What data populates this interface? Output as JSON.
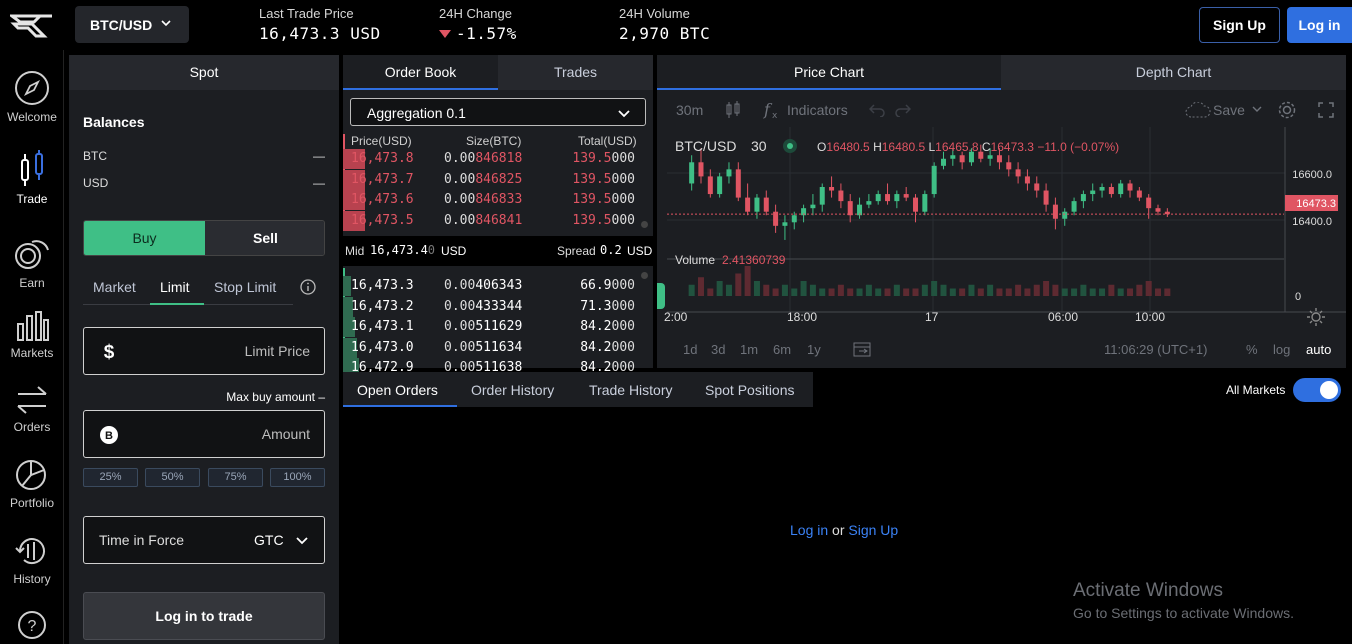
{
  "topbar": {
    "pair": "BTC/USD",
    "last_trade_label": "Last Trade Price",
    "last_trade_value": "16,473.3 USD",
    "change_label": "24H Change",
    "change_value": "-1.57%",
    "volume_label": "24H Volume",
    "volume_value": "2,970 BTC",
    "signup": "Sign Up",
    "login": "Log in"
  },
  "rail": {
    "items": [
      {
        "label": "Welcome",
        "icon": "compass-icon"
      },
      {
        "label": "Trade",
        "icon": "candlestick-icon"
      },
      {
        "label": "Earn",
        "icon": "coins-icon"
      },
      {
        "label": "Markets",
        "icon": "bars-icon"
      },
      {
        "label": "Orders",
        "icon": "arrows-exchange-icon"
      },
      {
        "label": "Portfolio",
        "icon": "pie-icon"
      },
      {
        "label": "History",
        "icon": "history-icon"
      }
    ],
    "help_icon": "question-icon"
  },
  "spot": {
    "title": "Spot",
    "balances_title": "Balances",
    "balances": [
      {
        "asset": "BTC",
        "value": "—"
      },
      {
        "asset": "USD",
        "value": "—"
      }
    ],
    "buy": "Buy",
    "sell": "Sell",
    "order_types": [
      "Market",
      "Limit",
      "Stop Limit"
    ],
    "limit_price_placeholder": "Limit Price",
    "max_buy": "Max buy amount –",
    "amount_placeholder": "Amount",
    "percents": [
      "25%",
      "50%",
      "75%",
      "100%"
    ],
    "tif_label": "Time in Force",
    "tif_value": "GTC",
    "login_trade": "Log in to trade"
  },
  "book": {
    "tab_book": "Order Book",
    "tab_trades": "Trades",
    "aggregation": "Aggregation 0.1",
    "col_price": "Price(USD)",
    "col_size": "Size(BTC)",
    "col_total": "Total(USD)",
    "asks": [
      {
        "price": "16,473.8",
        "size_a": "0.00",
        "size_b": "846818",
        "total_a": "139.5",
        "total_b": "000"
      },
      {
        "price": "16,473.7",
        "size_a": "0.00",
        "size_b": "846825",
        "total_a": "139.5",
        "total_b": "000"
      },
      {
        "price": "16,473.6",
        "size_a": "0.00",
        "size_b": "846833",
        "total_a": "139.5",
        "total_b": "000"
      },
      {
        "price": "16,473.5",
        "size_a": "0.00",
        "size_b": "846841",
        "total_a": "139.5",
        "total_b": "000"
      }
    ],
    "mid_label": "Mid",
    "mid_value": "16,473.4",
    "mid_dim": "0",
    "mid_unit": "USD",
    "spread_label": "Spread",
    "spread_value": "0.2",
    "spread_unit": "USD",
    "bids": [
      {
        "price": "16,473.3",
        "size_a": "0.00",
        "size_b": "406343",
        "total_a": "66.9",
        "total_b": "000"
      },
      {
        "price": "16,473.2",
        "size_a": "0.00",
        "size_b": "433344",
        "total_a": "71.3",
        "total_b": "000"
      },
      {
        "price": "16,473.1",
        "size_a": "0.00",
        "size_b": "511629",
        "total_a": "84.2",
        "total_b": "000"
      },
      {
        "price": "16,473.0",
        "size_a": "0.00",
        "size_b": "511634",
        "total_a": "84.2",
        "total_b": "000"
      },
      {
        "price": "16,472.9",
        "size_a": "0.00",
        "size_b": "511638",
        "total_a": "84.2",
        "total_b": "000"
      }
    ]
  },
  "chart": {
    "tab_price": "Price Chart",
    "tab_depth": "Depth Chart",
    "interval": "30m",
    "indicators": "Indicators",
    "save": "Save",
    "symbol": "BTC/USD",
    "symbol_interval": "30",
    "o_label": "O",
    "o_value": "16480.5",
    "h_label": "H",
    "h_value": "16480.5",
    "l_label": "L",
    "l_value": "16465.8",
    "c_label": "C",
    "c_value": "16473.3",
    "change": "−11.0 (−0.07%)",
    "volume_label": "Volume",
    "volume_value": "2.41360739",
    "y_ticks": [
      "16600.0",
      "16400.0"
    ],
    "last_price_tag": "16473.3",
    "vol_zero": "0",
    "x_ticks": [
      "2:00",
      "18:00",
      "17",
      "06:00",
      "10:00"
    ],
    "ranges": [
      "1d",
      "3d",
      "1m",
      "6m",
      "1y"
    ],
    "time": "11:06:29 (UTC+1)",
    "pct": "%",
    "log": "log",
    "auto": "auto"
  },
  "bottom": {
    "tabs": [
      "Open Orders",
      "Order History",
      "Trade History",
      "Spot Positions"
    ],
    "all_markets": "All Markets",
    "login_text": "Log in",
    "or_text": "or",
    "signup_text": "Sign Up"
  },
  "watermark": {
    "line1": "Activate Windows",
    "line2": "Go to Settings to activate Windows."
  },
  "colors": {
    "green": "#3fbf86",
    "red": "#e05563",
    "accent": "#2f6fe0"
  },
  "chart_data": {
    "type": "candlestick",
    "ohlc": [
      [
        16560,
        16640,
        16540,
        16620
      ],
      [
        16620,
        16660,
        16560,
        16580
      ],
      [
        16580,
        16600,
        16520,
        16530
      ],
      [
        16530,
        16590,
        16520,
        16580
      ],
      [
        16580,
        16620,
        16560,
        16600
      ],
      [
        16600,
        16620,
        16510,
        16520
      ],
      [
        16520,
        16560,
        16470,
        16480
      ],
      [
        16480,
        16530,
        16460,
        16520
      ],
      [
        16520,
        16540,
        16470,
        16480
      ],
      [
        16480,
        16500,
        16420,
        16440
      ],
      [
        16440,
        16470,
        16400,
        16450
      ],
      [
        16450,
        16480,
        16430,
        16470
      ],
      [
        16470,
        16500,
        16450,
        16490
      ],
      [
        16490,
        16530,
        16470,
        16500
      ],
      [
        16500,
        16560,
        16480,
        16550
      ],
      [
        16550,
        16580,
        16520,
        16540
      ],
      [
        16540,
        16560,
        16490,
        16510
      ],
      [
        16510,
        16530,
        16450,
        16470
      ],
      [
        16470,
        16520,
        16460,
        16500
      ],
      [
        16500,
        16530,
        16490,
        16510
      ],
      [
        16510,
        16540,
        16500,
        16530
      ],
      [
        16530,
        16560,
        16500,
        16510
      ],
      [
        16510,
        16540,
        16490,
        16530
      ],
      [
        16530,
        16550,
        16510,
        16520
      ],
      [
        16520,
        16530,
        16450,
        16480
      ],
      [
        16480,
        16540,
        16470,
        16530
      ],
      [
        16530,
        16620,
        16520,
        16610
      ],
      [
        16610,
        16650,
        16600,
        16630
      ],
      [
        16630,
        16660,
        16610,
        16640
      ],
      [
        16640,
        16650,
        16600,
        16620
      ],
      [
        16620,
        16660,
        16610,
        16650
      ],
      [
        16650,
        16670,
        16620,
        16630
      ],
      [
        16630,
        16660,
        16610,
        16640
      ],
      [
        16640,
        16660,
        16600,
        16620
      ],
      [
        16620,
        16640,
        16580,
        16600
      ],
      [
        16600,
        16620,
        16560,
        16580
      ],
      [
        16580,
        16600,
        16540,
        16560
      ],
      [
        16560,
        16580,
        16520,
        16540
      ],
      [
        16540,
        16560,
        16480,
        16500
      ],
      [
        16500,
        16520,
        16430,
        16460
      ],
      [
        16460,
        16490,
        16440,
        16480
      ],
      [
        16480,
        16520,
        16470,
        16510
      ],
      [
        16510,
        16540,
        16490,
        16530
      ],
      [
        16530,
        16560,
        16510,
        16540
      ],
      [
        16540,
        16560,
        16520,
        16550
      ],
      [
        16550,
        16560,
        16520,
        16530
      ],
      [
        16530,
        16570,
        16520,
        16560
      ],
      [
        16560,
        16570,
        16520,
        16540
      ],
      [
        16540,
        16550,
        16510,
        16520
      ],
      [
        16520,
        16530,
        16460,
        16490
      ],
      [
        16490,
        16500,
        16470,
        16480
      ],
      [
        16480,
        16490,
        16465,
        16473
      ]
    ],
    "volume": [
      3,
      5,
      2,
      4,
      3,
      6,
      8,
      4,
      3,
      2,
      3,
      2,
      4,
      3,
      2,
      2,
      3,
      2,
      2,
      3,
      2,
      2,
      3,
      2,
      2,
      3,
      4,
      3,
      2,
      2,
      3,
      2,
      3,
      2,
      2,
      3,
      2,
      3,
      4,
      3,
      2,
      2,
      3,
      2,
      2,
      3,
      2,
      2,
      3,
      4,
      2,
      2
    ],
    "ylim": [
      16380,
      16720
    ],
    "last_price": 16473.3
  }
}
